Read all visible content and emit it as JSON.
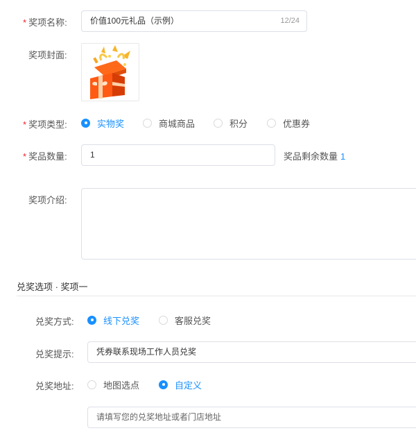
{
  "prize": {
    "name_label": "奖项名称:",
    "name_value": "价值100元礼品（示例）",
    "name_count": "12/24",
    "cover_label": "奖项封面:",
    "cover_icon": "gift-box-icon",
    "type_label": "奖项类型:",
    "type_options": [
      "实物奖",
      "商城商品",
      "积分",
      "优惠券"
    ],
    "type_selected": "实物奖",
    "qty_label": "奖品数量:",
    "qty_value": "1",
    "remain_label": "奖品剩余数量",
    "remain_value": "1",
    "intro_label": "奖项介绍:",
    "intro_value": ""
  },
  "redeem": {
    "section_title": "兑奖选项 · 奖项一",
    "method_label": "兑奖方式:",
    "method_options": [
      "线下兑奖",
      "客服兑奖"
    ],
    "method_selected": "线下兑奖",
    "tip_label": "兑奖提示:",
    "tip_value": "凭券联系现场工作人员兑奖",
    "addr_label": "兑奖地址:",
    "addr_options": [
      "地图选点",
      "自定义"
    ],
    "addr_selected": "自定义",
    "addr_placeholder": "请填写您的兑奖地址或者门店地址"
  },
  "colors": {
    "accent": "#1890ff",
    "required": "#f5222d",
    "border": "#dcdfe6"
  }
}
